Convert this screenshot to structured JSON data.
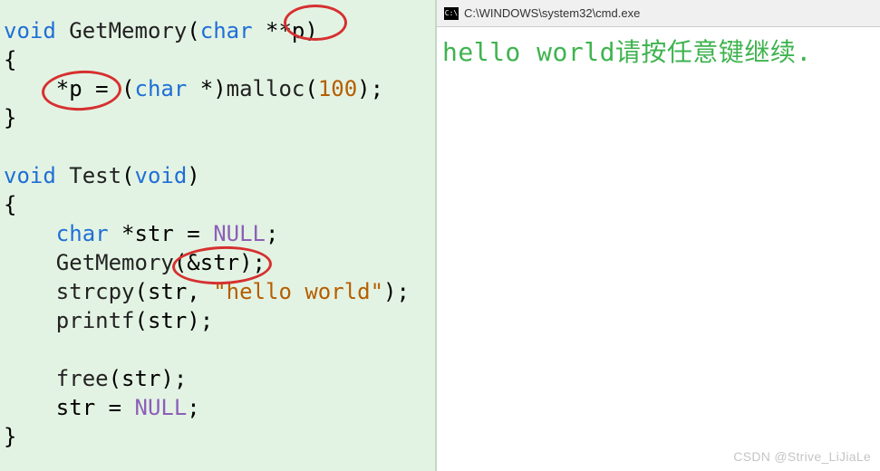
{
  "code": {
    "lines": [
      {
        "type": "sig",
        "kw": "void",
        "sp": " ",
        "name": "GetMemory",
        "paren_open": "(",
        "param_kw": "char",
        "param_rest": " **p)"
      },
      {
        "type": "brace",
        "text": "{"
      },
      {
        "type": "assign",
        "indent": "    ",
        "lhs": "*p = ",
        "cast_open": "(",
        "cast_kw": "char",
        "cast_rest": " *)",
        "call": "malloc",
        "args_open": "(",
        "num": "100",
        "args_close": ");"
      },
      {
        "type": "brace",
        "text": "}"
      },
      {
        "type": "blank",
        "text": ""
      },
      {
        "type": "sig",
        "kw": "void",
        "sp": " ",
        "name": "Test",
        "paren_open": "(",
        "param_kw": "void",
        "param_rest": ")"
      },
      {
        "type": "brace",
        "text": "{"
      },
      {
        "type": "decl",
        "indent": "    ",
        "kw": "char",
        "rest": " *str = ",
        "null": "NULL",
        "semi": ";"
      },
      {
        "type": "call",
        "indent": "    ",
        "name": "GetMemory",
        "args": "(&str);"
      },
      {
        "type": "call2",
        "indent": "    ",
        "name": "strcpy",
        "open": "(str, ",
        "str": "\"hello world\"",
        "close": ");"
      },
      {
        "type": "call",
        "indent": "    ",
        "name": "printf",
        "args": "(str);"
      },
      {
        "type": "blank",
        "text": ""
      },
      {
        "type": "call",
        "indent": "    ",
        "name": "free",
        "args": "(str);"
      },
      {
        "type": "assign2",
        "indent": "    ",
        "lhs": "str = ",
        "null": "NULL",
        "semi": ";"
      },
      {
        "type": "brace",
        "text": "}"
      }
    ]
  },
  "console": {
    "title": "C:\\WINDOWS\\system32\\cmd.exe",
    "output": "hello world请按任意键继续."
  },
  "watermark": "CSDN @Strive_LiJiaLe"
}
